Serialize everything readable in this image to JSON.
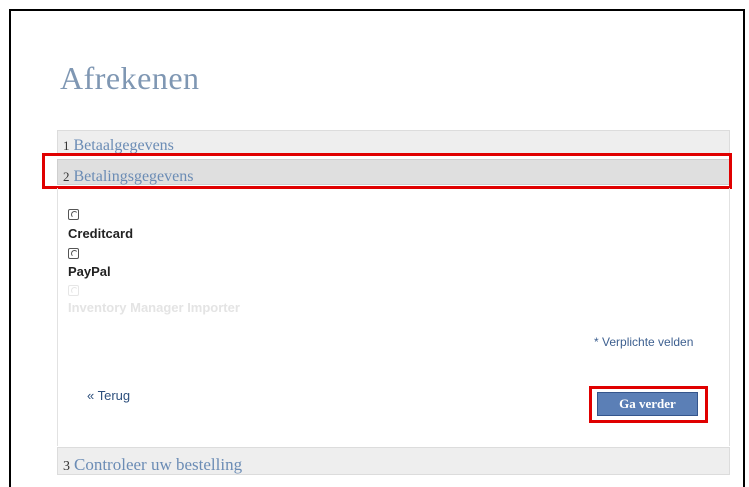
{
  "page": {
    "title": "Afrekenen"
  },
  "steps": [
    {
      "number": "1",
      "label": "Betaalgegevens"
    },
    {
      "number": "2",
      "label": "Betalingsgegevens"
    },
    {
      "number": "3",
      "label": "Controleer uw bestelling"
    }
  ],
  "payment_options": [
    {
      "label": "Creditcard",
      "enabled": true
    },
    {
      "label": "PayPal",
      "enabled": true
    },
    {
      "label": "Inventory Manager Importer",
      "enabled": false
    }
  ],
  "required_note": "* Verplichte velden",
  "back_link": "« Terug",
  "continue_button": "Ga verder",
  "colors": {
    "title": "#7f97b3",
    "step_label": "#6b8cb5",
    "highlight": "#e00000",
    "button": "#5b7fb6"
  }
}
